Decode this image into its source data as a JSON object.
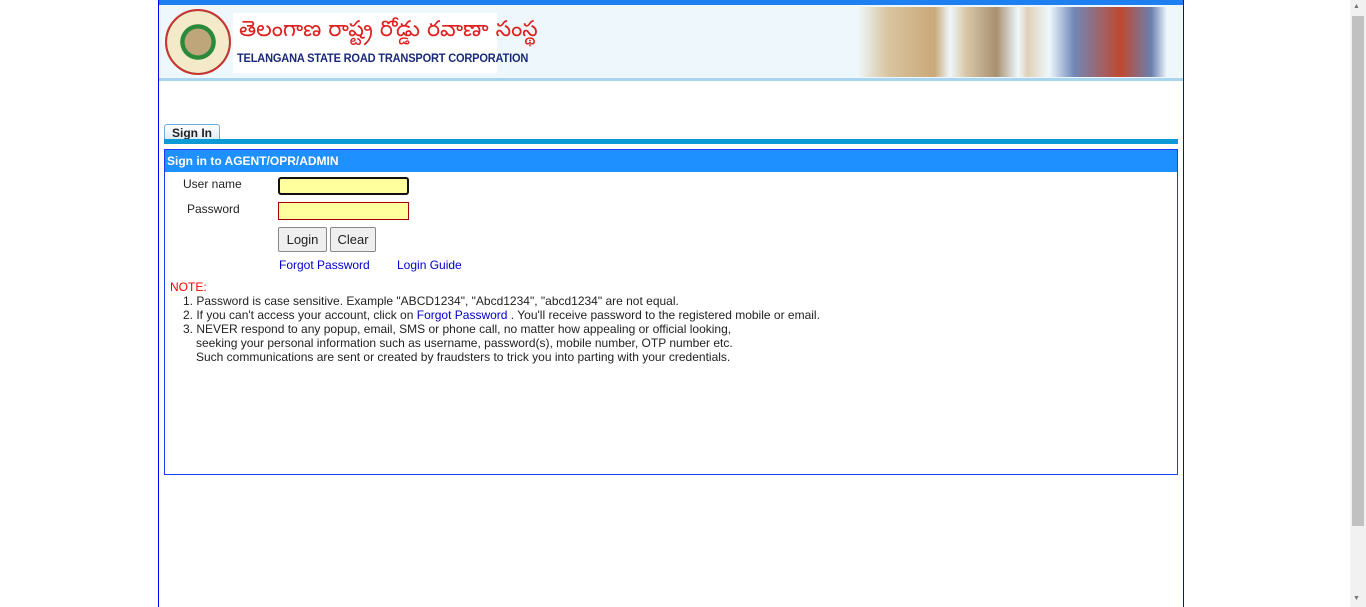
{
  "header": {
    "telugu_title": "తెలంగాణ  రాష్ట్ర రోడ్డు రవాణా సంస్థ",
    "english_title": "TELANGANA STATE ROAD TRANSPORT CORPORATION"
  },
  "tab": {
    "label": "Sign In"
  },
  "panel": {
    "title": "Sign in to AGENT/OPR/ADMIN",
    "username_label": "User name",
    "password_label": "Password",
    "username_value": "",
    "password_value": "",
    "login_label": "Login",
    "clear_label": "Clear",
    "forgot_label": "Forgot Password",
    "guide_label": "Login Guide"
  },
  "note": {
    "heading": "NOTE:",
    "item1": "1. Password is case sensitive. Example \"ABCD1234\", \"Abcd1234\", \"abcd1234\" are not equal.",
    "item2_pre": "2. If you can't access your account, click on ",
    "item2_link": "Forgot Password",
    "item2_post": " .  You'll receive password to the registered mobile or email.",
    "item3_line1": "3. NEVER respond to any popup, email, SMS or phone call, no matter how appealing or official looking,",
    "item3_line2": "seeking your personal information such as username, password(s), mobile number, OTP number etc.",
    "item3_line3": "Such communications are sent or created by fraudsters to trick you into parting with your credentials."
  }
}
